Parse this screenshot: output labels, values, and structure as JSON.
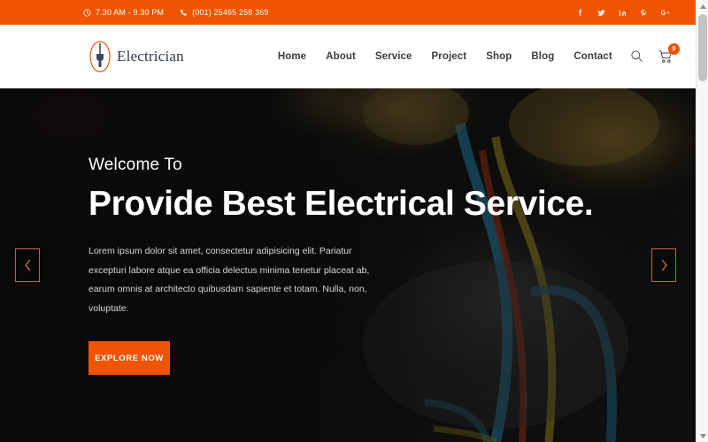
{
  "topbar": {
    "hours": "7.30 AM - 9.30 PM",
    "hours_icon": "clock-icon",
    "phone": "(001) 25465 258 369",
    "phone_icon": "phone-icon",
    "social": [
      {
        "name": "facebook-icon",
        "label": "f"
      },
      {
        "name": "twitter-icon",
        "label": "t"
      },
      {
        "name": "linkedin-icon",
        "label": "in"
      },
      {
        "name": "pinterest-icon",
        "label": "P"
      },
      {
        "name": "google-plus-icon",
        "label": "G+"
      }
    ],
    "bg_color": "#ef5400"
  },
  "header": {
    "logo_text": "Electrician",
    "logo_icon": "electric-plug-icon",
    "nav": [
      {
        "label": "Home"
      },
      {
        "label": "About"
      },
      {
        "label": "Service"
      },
      {
        "label": "Project"
      },
      {
        "label": "Shop"
      },
      {
        "label": "Blog"
      },
      {
        "label": "Contact"
      }
    ],
    "search_icon": "search-icon",
    "cart_icon": "shopping-cart-icon",
    "cart_count": "0"
  },
  "hero": {
    "welcome": "Welcome To",
    "title": "Provide Best Electrical Service.",
    "description": "Lorem ipsum dolor sit amet, consectetur adipisicing elit. Pariatur excepturi labore atque ea officia delectus minima tenetur placeat ab, earum omnis at architecto quibusdam sapiente et totam. Nulla, non, voluptate.",
    "cta_label": "EXPLORE NOW",
    "prev_icon": "chevron-left-icon",
    "next_icon": "chevron-right-icon",
    "accent_color": "#ef5400"
  },
  "scrollbar": {
    "up_icon": "scroll-up-arrow-icon",
    "down_icon": "scroll-down-arrow-icon",
    "thumb_name": "scrollbar-thumb"
  }
}
